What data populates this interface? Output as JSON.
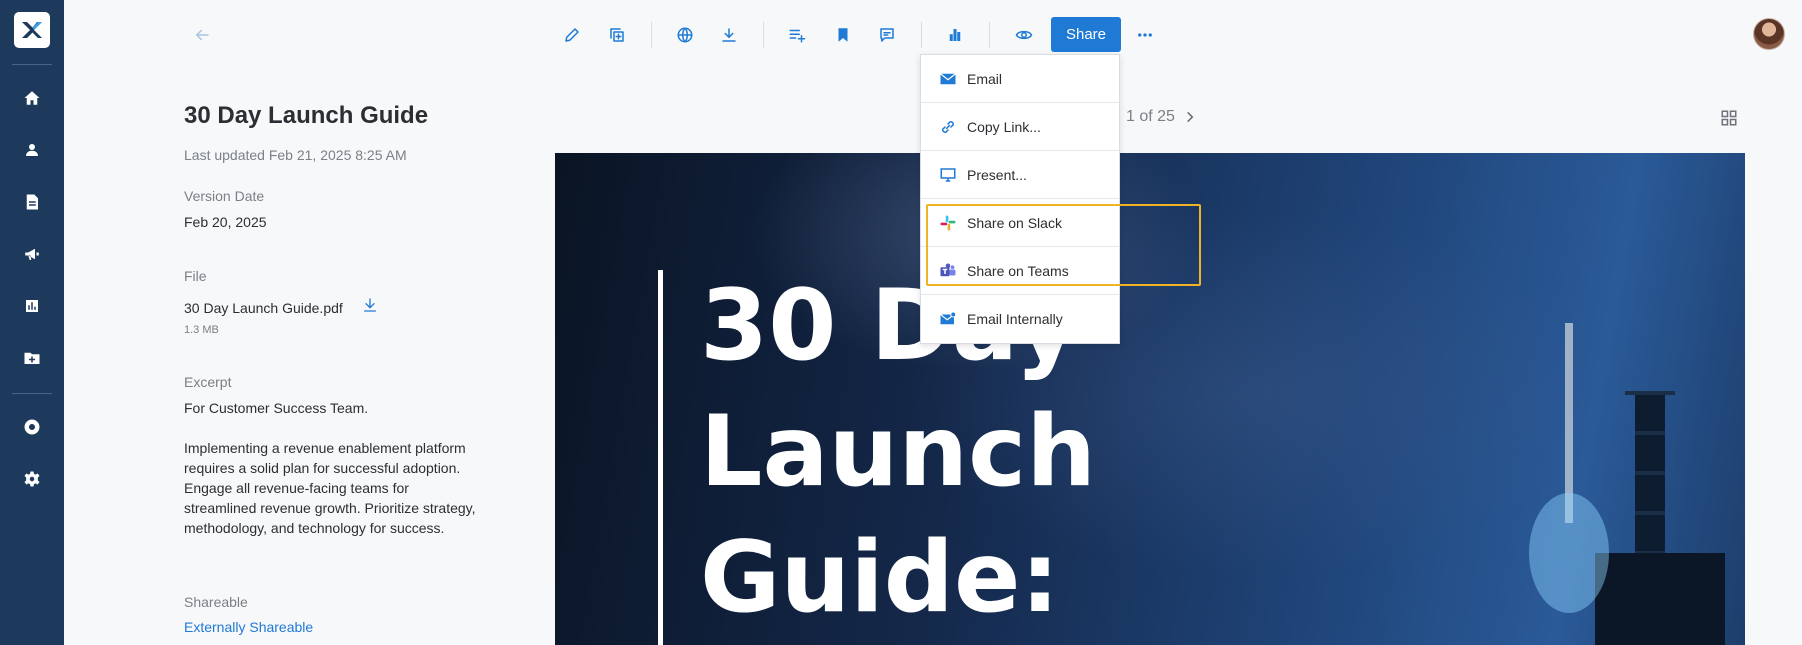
{
  "toolbar": {
    "share_label": "Share"
  },
  "document": {
    "title": "30 Day Launch Guide",
    "last_updated": "Last updated Feb 21, 2025 8:25 AM",
    "version_date_label": "Version Date",
    "version_date": "Feb 20, 2025",
    "file_label": "File",
    "file_name": "30 Day Launch Guide.pdf",
    "file_size": "1.3 MB",
    "excerpt_label": "Excerpt",
    "excerpt_line1": "For Customer Success Team.",
    "excerpt_body": "Implementing a revenue enablement platform requires a solid plan for successful adoption. Engage all revenue-facing teams for streamlined revenue growth. Prioritize strategy, methodology, and technology for success.",
    "shareable_label": "Shareable",
    "shareable_value": "Externally Shareable"
  },
  "page_nav": {
    "text": "1 of 25"
  },
  "preview": {
    "line1": "30 Day",
    "line2": "Launch",
    "line3": "Guide:"
  },
  "share_menu": {
    "items": [
      {
        "label": "Email",
        "icon": "envelope-icon"
      },
      {
        "label": "Copy Link...",
        "icon": "link-icon"
      },
      {
        "label": "Present...",
        "icon": "monitor-icon"
      },
      {
        "label": "Share on Slack",
        "icon": "slack-icon"
      },
      {
        "label": "Share on Teams",
        "icon": "teams-icon"
      },
      {
        "label": "Email Internally",
        "icon": "envelope-internal-icon"
      }
    ]
  },
  "colors": {
    "sidebar": "#1d3a5c",
    "accent": "#1f7ad6",
    "highlight": "#f0b323"
  }
}
